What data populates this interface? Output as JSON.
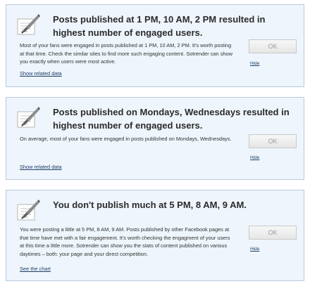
{
  "cards": [
    {
      "title": "Posts published at 1 PM, 10 AM, 2 PM resulted in highest number of engaged users.",
      "description": "Most of your fans were engaged in posts published at 1 PM, 10 AM, 2 PM. It's worth posting at that time. Check the similar sites to find more such engaging content. Sotrender can show you exactly when users were most active.",
      "link_label": "Show related data",
      "ok_label": "OK",
      "hide_label": "Hide",
      "icon": "quill-on-paper-icon"
    },
    {
      "title": "Posts published on Mondays, Wednesdays resulted in highest number of engaged users.",
      "description": "On average, most of your fans were engaged in posts published on Mondays, Wednesdays.",
      "link_label": "Show related data",
      "ok_label": "OK",
      "hide_label": "Hide",
      "icon": "quill-on-paper-icon"
    },
    {
      "title": "You don't publish much at 5 PM, 8 AM, 9 AM.",
      "description": "You were posting a little at 5 PM, 8 AM, 9 AM. Posts published by other Facebook pages at that time have met with a fair engagement. It's worth checking the engagment of your users at this time a little more. Sotrender can show you the stats of content published on various daytimes – both: your page and your direct competition.",
      "link_label": "See the chart",
      "ok_label": "OK",
      "hide_label": "Hide",
      "icon": "quill-on-paper-icon"
    }
  ],
  "colors": {
    "card_background": "#eef5fc",
    "card_border": "#b7cbde",
    "link": "#1f3f66",
    "title": "#2b2b2b"
  }
}
